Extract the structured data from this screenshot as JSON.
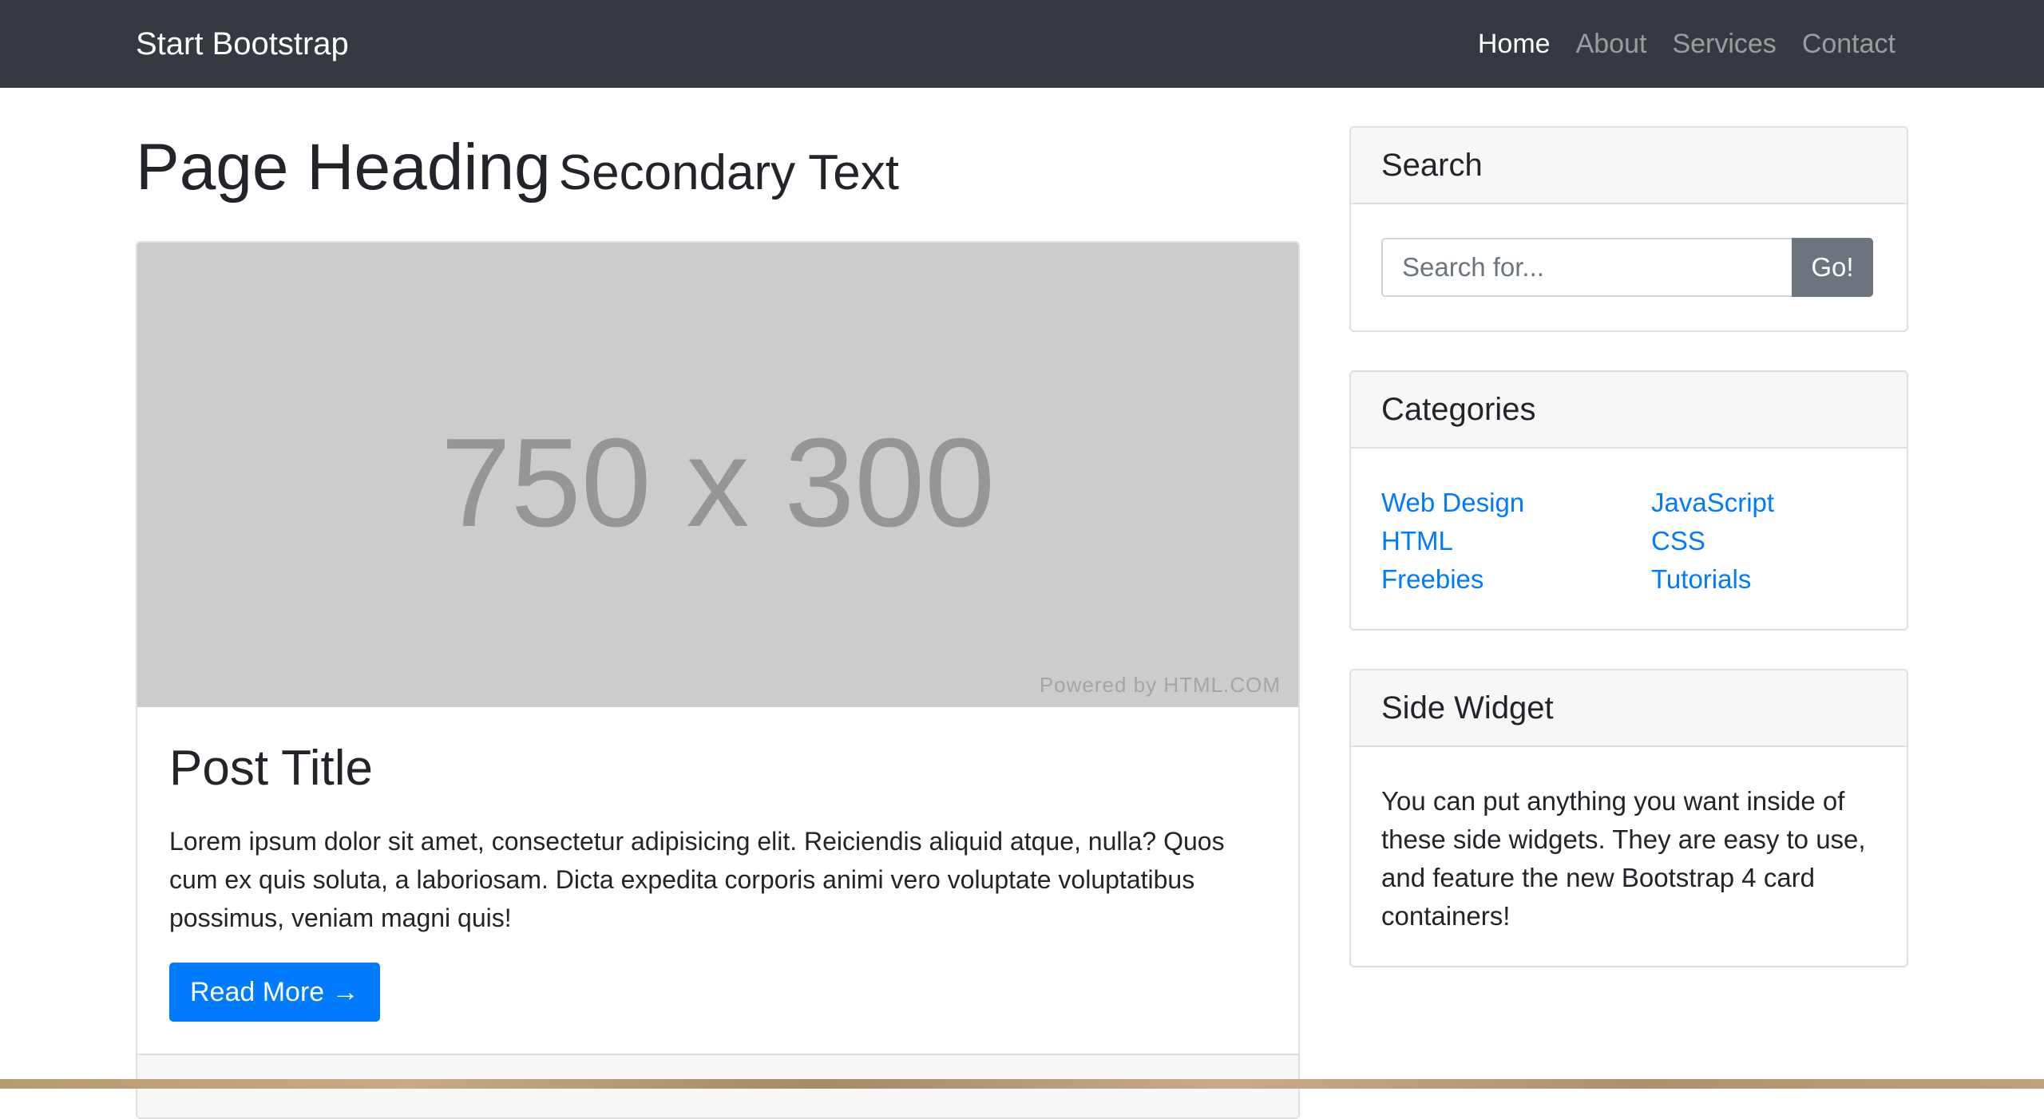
{
  "navbar": {
    "brand": "Start Bootstrap",
    "links": [
      {
        "label": "Home",
        "active": true
      },
      {
        "label": "About",
        "active": false
      },
      {
        "label": "Services",
        "active": false
      },
      {
        "label": "Contact",
        "active": false
      }
    ]
  },
  "heading": {
    "main": "Page Heading",
    "secondary": "Secondary Text"
  },
  "post": {
    "image_dims": "750 x 300",
    "image_credit": "Powered by HTML.COM",
    "title": "Post Title",
    "text": "Lorem ipsum dolor sit amet, consectetur adipisicing elit. Reiciendis aliquid atque, nulla? Quos cum ex quis soluta, a laboriosam. Dicta expedita corporis animi vero voluptate voluptatibus possimus, veniam magni quis!",
    "read_more_label": "Read More →"
  },
  "sidebar": {
    "search": {
      "title": "Search",
      "placeholder": "Search for...",
      "button_label": "Go!"
    },
    "categories": {
      "title": "Categories",
      "items": [
        "Web Design",
        "JavaScript",
        "HTML",
        "CSS",
        "Freebies",
        "Tutorials"
      ]
    },
    "widget": {
      "title": "Side Widget",
      "text": "You can put anything you want inside of these side widgets. They are easy to use, and feature the new Bootstrap 4 card containers!"
    }
  },
  "colors": {
    "navbar_bg": "#343a40",
    "link": "#007bff",
    "primary_button": "#007bff",
    "secondary_button": "#6c757d",
    "image_placeholder": "#cccccc"
  }
}
